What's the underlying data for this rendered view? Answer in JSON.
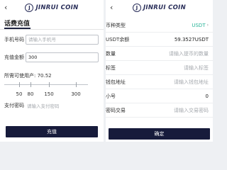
{
  "brand": {
    "logo_letter": "J",
    "name": "JINRUI COIN"
  },
  "left": {
    "back_icon": "chevron-left-icon",
    "tab_label": "话费充值",
    "phone": {
      "label": "手机号码",
      "placeholder": "请输入手机号"
    },
    "amount": {
      "label": "充值金额",
      "value": "300"
    },
    "available": {
      "label": "所需可使用产:",
      "value": "70.52"
    },
    "preset_amounts": [
      "50",
      "80",
      "150",
      "300"
    ],
    "password": {
      "label": "支付密码",
      "placeholder": "请输入支付密码"
    },
    "submit_label": "充值"
  },
  "right": {
    "back_icon": "chevron-left-icon",
    "rows": [
      {
        "label": "币种类型",
        "value": "USDT"
      },
      {
        "label": "USDT余额",
        "value": "59.3527USDT"
      },
      {
        "label": "数量",
        "value": "请输入提币的数量"
      },
      {
        "label": "标签",
        "value": "请输入标签"
      },
      {
        "label": "钱包地址",
        "value": "请输入钱包地址"
      },
      {
        "label": "小号",
        "value": "0"
      },
      {
        "label": "密码交易",
        "value": "请输入交易密码"
      }
    ],
    "submit_label": "确定"
  },
  "colors": {
    "brand_dark": "#171b3b",
    "accent": "#2bb59a",
    "placeholder": "#a5a9ae"
  }
}
